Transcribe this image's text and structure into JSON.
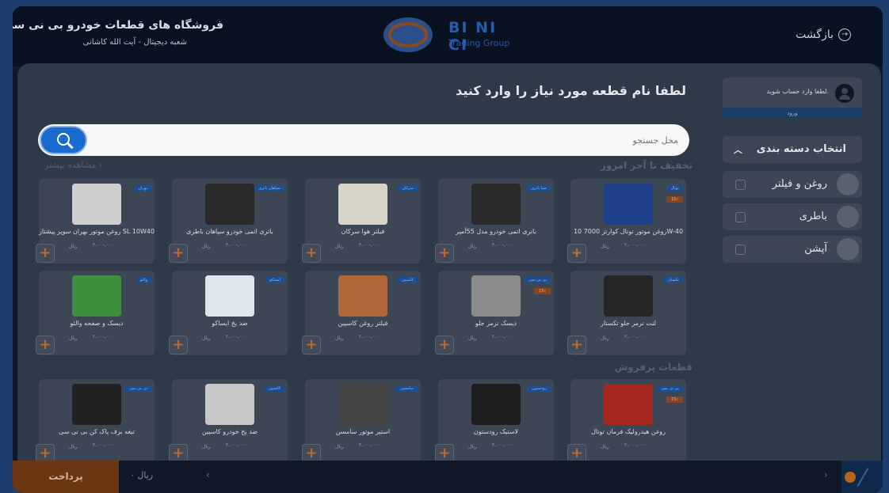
{
  "header": {
    "store_name": "فروشگاه های قطعات خودرو بی نی سی",
    "branch": "شعبه دیجیتال - آیت الله کاشانی",
    "logo_brand": "BI NI CI",
    "logo_sub": "Trading Group",
    "back_label": "بازگشت"
  },
  "prompt": "لطفا نام قطعه مورد نیاز را وارد کنید",
  "account": {
    "message": "لطفا وارد حساب شوید.",
    "login_label": "ورود"
  },
  "search": {
    "placeholder": "محل جستجو"
  },
  "sections": {
    "today": "تخفیف تا آخر امروز",
    "more": "مشاهده بیشتر",
    "bestsellers": "قطعات پرفروش"
  },
  "categories": {
    "header": "انتخاب دسته بندی",
    "items": [
      {
        "label": "روغن و فیلتر"
      },
      {
        "label": "باطری"
      },
      {
        "label": "آپشن"
      }
    ]
  },
  "currency": "ریال",
  "products": [
    {
      "name": "روغن موتور توتال کوارتز 7000 10W-40",
      "brand": "توتال",
      "discount": "15٪",
      "price": "۲,۰۰۰,۰۰۰"
    },
    {
      "name": "باتری اتمی خودرو مدل 55آمپر",
      "brand": "صبا باتری",
      "price": "۲,۰۰۰,۰۰۰"
    },
    {
      "name": "فیلتر هوا سرکان",
      "brand": "سرکان",
      "price": "۲,۰۰۰,۰۰۰"
    },
    {
      "name": "باتری اتمی خودرو سپاهان باطری",
      "brand": "سپاهان باتری",
      "price": "۲,۰۰۰,۰۰۰"
    },
    {
      "name": "روغن موتور بهران سوپر پیشتاز SL 10W40",
      "brand": "بهران",
      "price": "۲,۰۰۰,۰۰۰"
    },
    {
      "name": "لنت ترمز جلو تکستار",
      "brand": "تکستار",
      "price": "۲,۰۰۰,۰۰۰"
    },
    {
      "name": "دیسک ترمز جلو",
      "brand": "بی نی سی",
      "discount": "15٪",
      "price": "۲,۰۰۰,۰۰۰"
    },
    {
      "name": "فیلتر روغن کاسپین",
      "brand": "کاسپین",
      "price": "۲,۰۰۰,۰۰۰"
    },
    {
      "name": "ضد یخ ایساکو",
      "brand": "ایساکو",
      "price": "۲,۰۰۰,۰۰۰"
    },
    {
      "name": "دیسک و صفحه والئو",
      "brand": "والئو",
      "price": "۲,۰۰۰,۰۰۰"
    },
    {
      "name": "روغن هیدرولیک فرمان توتال",
      "brand": "بی نی سی",
      "discount": "15٪",
      "price": "۲,۰۰۰,۰۰۰"
    },
    {
      "name": "لاستیک رودستون",
      "brand": "رودستون",
      "price": "۲,۰۰۰,۰۰۰"
    },
    {
      "name": "استپر موتور سامسن",
      "brand": "سامسن",
      "price": "۲,۰۰۰,۰۰۰"
    },
    {
      "name": "ضد یخ خودرو کاسپین",
      "brand": "کاسپین",
      "price": "۲,۰۰۰,۰۰۰"
    },
    {
      "name": "تیغه برف پاک کن بی نی سی",
      "brand": "بی نی سی",
      "price": "۲,۰۰۰,۰۰۰"
    }
  ],
  "footer": {
    "pay_label": "پرداخت",
    "total_value": "۰",
    "total_currency": "ریال"
  }
}
